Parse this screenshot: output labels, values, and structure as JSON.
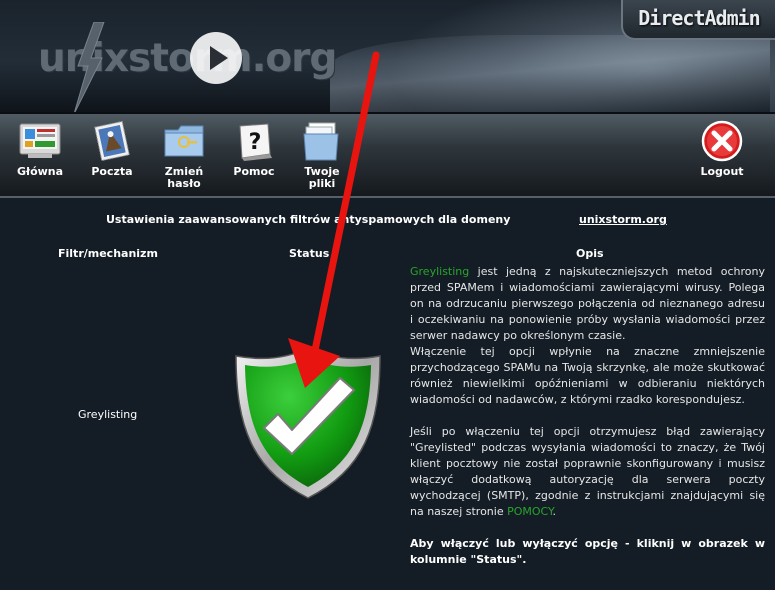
{
  "banner": {
    "logo_text": "unixstorm.org",
    "panel_brand": "DirectAdmin"
  },
  "nav": {
    "items": [
      {
        "label": "Główna",
        "icon": "home-icon"
      },
      {
        "label": "Poczta",
        "icon": "mail-stamp-icon"
      },
      {
        "label": "Zmień hasło",
        "icon": "folder-key-icon"
      },
      {
        "label": "Pomoc",
        "icon": "help-icon"
      },
      {
        "label": "Twoje pliki",
        "icon": "files-folder-icon"
      },
      {
        "label": "Logout",
        "icon": "close-icon"
      }
    ]
  },
  "page": {
    "heading": "Ustawienia zaawansowanych filtrów antyspamowych dla domeny",
    "domain": "unixstorm.org",
    "columns": {
      "filter": "Filtr/mechanizm",
      "status": "Status",
      "description": "Opis"
    },
    "row": {
      "filter_name": "Greylisting",
      "status_icon": "check-shield-icon",
      "description": {
        "p1_link": "Greylisting",
        "p1_text": " jest jedną z najskuteczniejszych metod ochrony przed SPAMem i wiadomościami zawierającymi wirusy. Polega on na odrzucaniu pierwszego połączenia od nieznanego adresu i oczekiwaniu na ponowienie próby wysłania wiadomości przez serwer nadawcy po określonym czasie.",
        "p2": "Włączenie tej opcji wpłynie na znaczne zmniejszenie przychodzącego SPAMu na Twoją skrzynkę, ale może skutkować również niewielkimi opóźnieniami w odbieraniu niektórych wiadomości od nadawców, z którymi rzadko korespondujesz.",
        "p3_text": "Jeśli po włączeniu tej opcji otrzymujesz błąd zawierający \"Greylisted\" podczas wysyłania wiadomości to znaczy, że Twój klient pocztowy nie został poprawnie skonfigurowany i musisz włączyć dodatkową autoryzację dla serwera poczty wychodzącej (SMTP), zgodnie z instrukcjami znajdującymi się na naszej stronie ",
        "p3_link": "POMOCY",
        "p3_end": ".",
        "p4": "Aby włączyć lub wyłączyć opcję - kliknij w obrazek w kolumnie \"Status\"."
      }
    }
  },
  "colors": {
    "background": "#141d26",
    "link_green": "#2aa42a",
    "arrow_red": "#e8140f"
  }
}
